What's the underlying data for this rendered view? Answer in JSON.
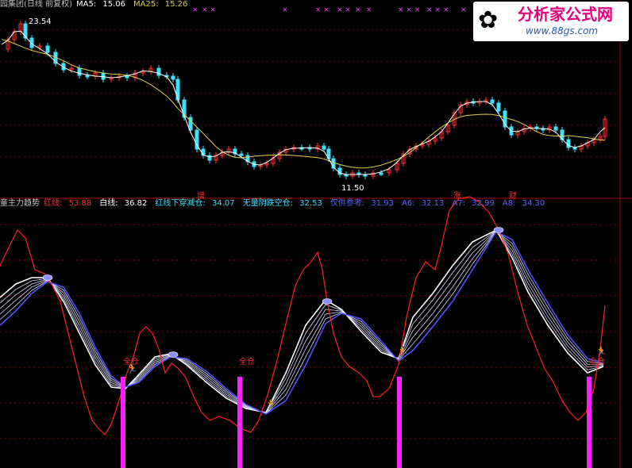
{
  "top_header": {
    "title": "园集团(日线 前复权)",
    "ma5_label": "MA5:",
    "ma5_value": "15.06",
    "ma25_label": "MA25:",
    "ma25_value": "15.26"
  },
  "top_markers": [
    "×",
    "× ×",
    "×",
    "× ×",
    "× ×",
    "×",
    "×",
    "× × ×",
    "× ×",
    "×",
    "×"
  ],
  "price_labels": {
    "high": "23.54",
    "low": "11.50"
  },
  "signal_labels": {
    "zeng": "增",
    "zhang": "涨",
    "cai": "财"
  },
  "bottom_header": {
    "indicator": "童主力趋势",
    "red_label": "红线:",
    "red_value": "53.88",
    "white_label": "白线:",
    "white_value": "36.82",
    "cross_label": "红线下穿减仓:",
    "cross_value": "34.07",
    "empty_label": "无量阴跌空仓:",
    "empty_value": "32.53",
    "ref_label": "仅供参考:",
    "ref_value": "31.93",
    "a6_label": "A6:",
    "a6_value": "32.13",
    "a7_label": "A7:",
    "a7_value": "32.99",
    "a8_label": "A8:",
    "a8_value": "34.30"
  },
  "signals": {
    "full1": "全仓",
    "full2": "全仓",
    "full3": "全仓"
  },
  "logo": {
    "title": "分析家公式网",
    "url": "www.88gs.com"
  },
  "colors": {
    "up": "#ff3030",
    "down": "#40e0ff",
    "ma5": "#ffffff",
    "ma25": "#e0d040",
    "red_line": "#ff2020",
    "white_line": "#ffffff",
    "blue_line": "#5050ff",
    "bar": "#ff20ff",
    "grid": "#800000"
  }
}
